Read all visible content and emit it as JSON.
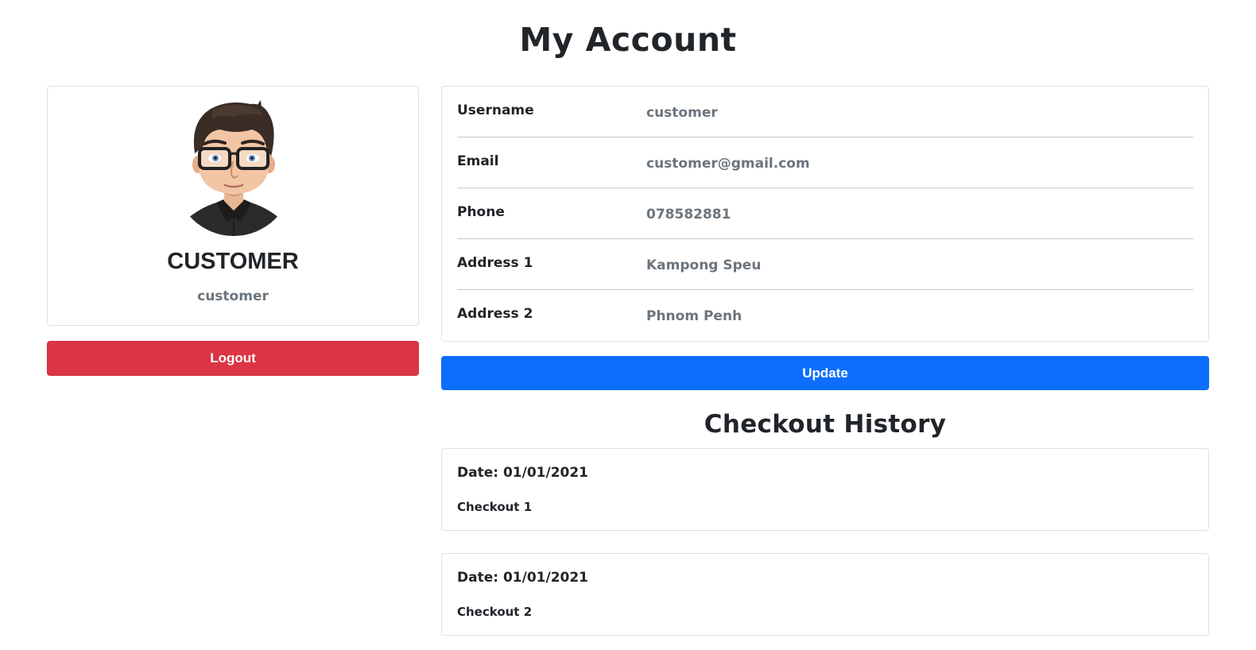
{
  "page": {
    "title": "My Account"
  },
  "profile": {
    "name": "CUSTOMER",
    "username": "customer",
    "logout_label": "Logout"
  },
  "details": {
    "rows": [
      {
        "label": "Username",
        "value": "customer"
      },
      {
        "label": "Email",
        "value": "customer@gmail.com"
      },
      {
        "label": "Phone",
        "value": "078582881"
      },
      {
        "label": "Address 1",
        "value": "Kampong Speu"
      },
      {
        "label": "Address 2",
        "value": "Phnom Penh"
      }
    ],
    "update_label": "Update"
  },
  "history": {
    "title": "Checkout History",
    "items": [
      {
        "date": "Date: 01/01/2021",
        "name": "Checkout 1"
      },
      {
        "date": "Date: 01/01/2021",
        "name": "Checkout 2"
      }
    ]
  },
  "colors": {
    "danger": "#dc3545",
    "primary": "#0d6efd",
    "muted": "#6c757d",
    "border": "#dee2e6"
  }
}
